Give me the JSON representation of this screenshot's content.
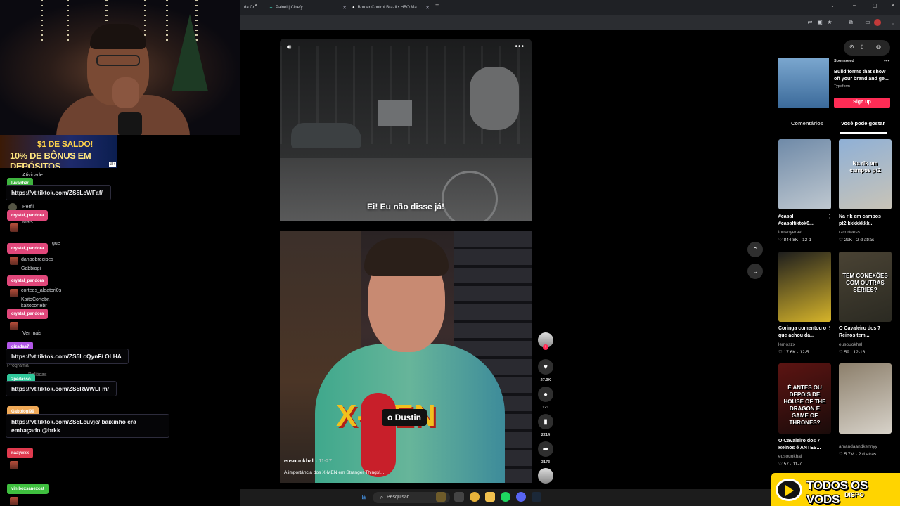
{
  "browser": {
    "tabs": [
      {
        "label": "da Cr"
      },
      {
        "label": "Painel | Cinefy"
      },
      {
        "label": "Border Control Brazil • HBO Ma"
      }
    ],
    "new_tab": "+",
    "window_controls": [
      "⌄",
      "–",
      "▢",
      "✕"
    ]
  },
  "stream": {
    "banner": {
      "line1": "$1 DE SALDO!",
      "line2": "10% DE BÔNUS EM DEPÓSITOS",
      "age": "18+"
    },
    "ghost_sidebar": {
      "activity": "Atividade",
      "profile": "Perfil",
      "more": "Mais",
      "follow_suffix": "gue",
      "accounts": [
        "danpobrecipes",
        "Gabbiogi",
        "cortees_aleatori0s",
        "KaitoCortebr.",
        "kaitocortebr"
      ],
      "see_more": "Ver mais",
      "program": "Programa",
      "policies": "Políticas"
    },
    "chat": [
      {
        "user": "luvanhzr",
        "color": "#3fb43f",
        "text": "https://vt.tiktok.com/ZS5LcWFaf/"
      },
      {
        "user": "crystal_pandora",
        "color": "#e0477a",
        "text": ""
      },
      {
        "user": "crystal_pandora",
        "color": "#e0477a",
        "text": ""
      },
      {
        "user": "crystal_pandora",
        "color": "#e0477a",
        "text": ""
      },
      {
        "user": "crystal_pandora",
        "color": "#e0477a",
        "text": ""
      },
      {
        "user": "gizadas7",
        "color": "#b257e8",
        "text": "https://vt.tiktok.com/ZS5LcQynF/ OLHA"
      },
      {
        "user": "2pedasso",
        "color": "#2fc79a",
        "text": "https://vt.tiktok.com/ZS5RWWLFm/"
      },
      {
        "user": "Gabbiogi99",
        "color": "#f0a957",
        "text": "https://vt.tiktok.com/ZS5Lcuvje/ baixinho era embaçado @brkk"
      },
      {
        "user": "naaywxx",
        "color": "#e03a4e",
        "text": ""
      },
      {
        "user": "viniboxsanexcat",
        "color": "#3fbf3f",
        "text": ""
      }
    ]
  },
  "video1": {
    "subtitle": "Ei! Eu não disse já!",
    "sound_icon": "speaker-icon",
    "more": "•••"
  },
  "video2": {
    "subtitle": "o Dustin",
    "logo_text": "X-MEN",
    "author": "eusouokhal",
    "date": "· 11-27",
    "description": "A importância dos X-MEN em Stranger Things!..."
  },
  "actions": {
    "likes": "27.3K",
    "comments": "121",
    "saves": "2214",
    "shares": "3173"
  },
  "right_panel": {
    "ad": {
      "sponsored": "Sponsored",
      "title": "Build forms that show off your brand and ge...",
      "brand": "Typeform",
      "cta": "Sign up"
    },
    "tabs": {
      "comments": "Comentários",
      "likes": "Você pode gostar"
    },
    "cards": [
      {
        "caption": "#casal #casaltiktok6...",
        "user": "lorranyeravi",
        "stats": "♡ 844.8K · 12-1",
        "thumb": [
          "#6f8aa8",
          "#bfc8d0"
        ],
        "overlay": ""
      },
      {
        "caption": "Na rlk em campos pt2 kkkkkkkk...",
        "user": "rzcorteess",
        "stats": "♡ 29K · 2 d atrás",
        "thumb": [
          "#8fb0d6",
          "#c9c4b7"
        ],
        "overlay": "Na rlk em campos pt2"
      },
      {
        "caption": "Coringa comentou o que achou da...",
        "user": "lemoszx",
        "stats": "♡ 17.6K · 12-5",
        "thumb": [
          "#1d1d1d",
          "#d6b42a"
        ],
        "overlay": ""
      },
      {
        "caption": "O Cavaleiro dos 7 Reinos tem...",
        "user": "eusouokhal",
        "stats": "♡ 59 · 12-16",
        "thumb": [
          "#4a4334",
          "#2b2a22"
        ],
        "overlay": "TEM CONEXÕES COM OUTRAS SÉRIES?"
      },
      {
        "caption": "O Cavaleiro dos 7 Reinos é ANTES...",
        "user": "eusouokhal",
        "stats": "♡ 57 · 11-7",
        "thumb": [
          "#5c1412",
          "#1a0b0a"
        ],
        "overlay": "É ANTES OU DEPOIS DE HOUSE OF THE DRAGON E GAME OF THRONES?"
      },
      {
        "caption": "",
        "user": "amandaandkennyy",
        "stats": "♡ 5.7M · 2 d atrás",
        "thumb": [
          "#8c7f6b",
          "#d7d2c9"
        ],
        "overlay": ""
      }
    ]
  },
  "taskbar": {
    "search_placeholder": "Pesquisar"
  },
  "promo": {
    "title": "TODOS OS VODS",
    "subtitle": "DISPO"
  }
}
